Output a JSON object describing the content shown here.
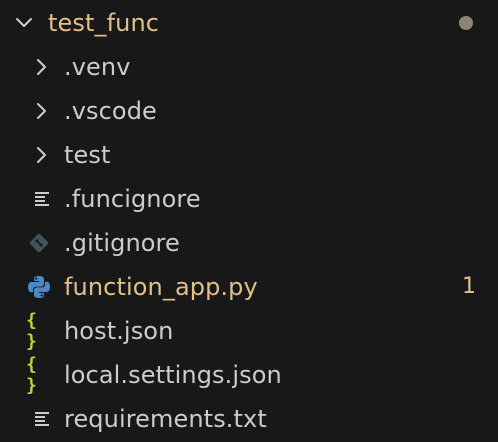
{
  "explorer": {
    "root": {
      "label": "test_func",
      "icon": "chevron-down-icon",
      "status": "modified",
      "indicator": "modified-dot"
    },
    "items": [
      {
        "label": ".venv",
        "type": "folder",
        "icon": "chevron-right-icon"
      },
      {
        "label": ".vscode",
        "type": "folder",
        "icon": "chevron-right-icon"
      },
      {
        "label": "test",
        "type": "folder",
        "icon": "chevron-right-icon"
      },
      {
        "label": ".funcignore",
        "type": "file",
        "icon": "lines-file-icon"
      },
      {
        "label": ".gitignore",
        "type": "file",
        "icon": "git-icon"
      },
      {
        "label": "function_app.py",
        "type": "file",
        "icon": "python-icon",
        "status": "modified",
        "problems": "1"
      },
      {
        "label": "host.json",
        "type": "file",
        "icon": "json-braces-icon"
      },
      {
        "label": "local.settings.json",
        "type": "file",
        "icon": "json-braces-icon"
      },
      {
        "label": "requirements.txt",
        "type": "file",
        "icon": "lines-file-icon"
      }
    ]
  },
  "colors": {
    "background": "#181818",
    "text": "#cccccc",
    "modified": "#e2c08d",
    "json": "#cbcb41",
    "python_blue": "#4f88c6",
    "python_yellow": "#ffd43b",
    "git": "#41535b"
  }
}
